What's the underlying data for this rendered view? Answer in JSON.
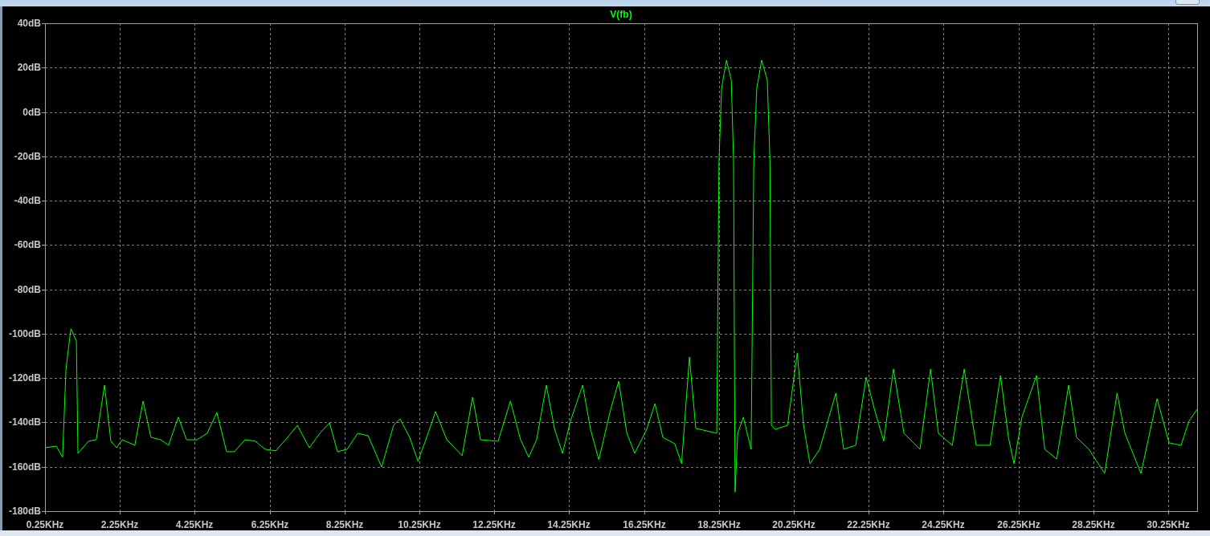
{
  "plot": {
    "chart_data": {
      "type": "line",
      "grid": true,
      "xlim": [
        0.25,
        31.02
      ],
      "ylim": [
        -180,
        40
      ],
      "yticks": [
        {
          "value": 40,
          "label": "40dB"
        },
        {
          "value": 20,
          "label": "20dB"
        },
        {
          "value": 0,
          "label": "0dB"
        },
        {
          "value": -20,
          "label": "-20dB"
        },
        {
          "value": -40,
          "label": "-40dB"
        },
        {
          "value": -60,
          "label": "-60dB"
        },
        {
          "value": -80,
          "label": "-80dB"
        },
        {
          "value": -100,
          "label": "-100dB"
        },
        {
          "value": -120,
          "label": "-120dB"
        },
        {
          "value": -140,
          "label": "-140dB"
        },
        {
          "value": -160,
          "label": "-160dB"
        },
        {
          "value": -180,
          "label": "-180dB"
        }
      ],
      "xticks": [
        {
          "value": 0.25,
          "label": "0.25KHz"
        },
        {
          "value": 2.25,
          "label": "2.25KHz"
        },
        {
          "value": 4.25,
          "label": "4.25KHz"
        },
        {
          "value": 6.25,
          "label": "6.25KHz"
        },
        {
          "value": 8.25,
          "label": "8.25KHz"
        },
        {
          "value": 10.25,
          "label": "10.25KHz"
        },
        {
          "value": 12.25,
          "label": "12.25KHz"
        },
        {
          "value": 14.25,
          "label": "14.25KHz"
        },
        {
          "value": 16.25,
          "label": "16.25KHz"
        },
        {
          "value": 18.25,
          "label": "18.25KHz"
        },
        {
          "value": 20.25,
          "label": "20.25KHz"
        },
        {
          "value": 22.25,
          "label": "22.25KHz"
        },
        {
          "value": 24.25,
          "label": "24.25KHz"
        },
        {
          "value": 26.25,
          "label": "26.25KHz"
        },
        {
          "value": 28.25,
          "label": "28.25KHz"
        },
        {
          "value": 30.25,
          "label": "30.25KHz"
        }
      ],
      "x": [
        0.25,
        0.55,
        0.72,
        0.81,
        0.94,
        1.09,
        1.13,
        1.41,
        1.62,
        1.84,
        2.01,
        2.16,
        2.31,
        2.65,
        2.87,
        3.08,
        3.34,
        3.55,
        3.81,
        4.03,
        4.31,
        4.58,
        4.84,
        5.1,
        5.31,
        5.59,
        5.87,
        6.13,
        6.41,
        6.73,
        6.99,
        7.31,
        7.59,
        7.85,
        8.06,
        8.32,
        8.6,
        8.88,
        9.24,
        9.56,
        9.73,
        9.99,
        10.21,
        10.42,
        10.68,
        10.98,
        11.39,
        11.67,
        11.88,
        12.35,
        12.68,
        12.95,
        13.17,
        13.38,
        13.64,
        13.86,
        14.07,
        14.28,
        14.61,
        14.82,
        15.04,
        15.36,
        15.57,
        15.79,
        16.0,
        16.32,
        16.54,
        16.75,
        17.07,
        17.25,
        17.46,
        17.63,
        17.82,
        18.19,
        18.25,
        18.32,
        18.45,
        18.58,
        18.64,
        18.68,
        18.75,
        18.9,
        19.11,
        19.18,
        19.26,
        19.39,
        19.54,
        19.61,
        19.65,
        19.76,
        20.08,
        20.34,
        20.51,
        20.68,
        20.94,
        21.37,
        21.58,
        21.9,
        22.18,
        22.4,
        22.65,
        22.91,
        23.19,
        23.62,
        23.9,
        24.11,
        24.48,
        24.8,
        25.12,
        25.49,
        25.77,
        25.98,
        26.13,
        26.34,
        26.73,
        26.95,
        27.27,
        27.59,
        27.8,
        28.13,
        28.55,
        28.88,
        29.09,
        29.52,
        29.95,
        30.27,
        30.59,
        30.8,
        31.02
      ],
      "series": [
        {
          "name": "V(fb)",
          "color": "#00ff00",
          "values": [
            -151.4,
            -150.7,
            -155.7,
            -115.9,
            -97.8,
            -103.3,
            -153.9,
            -148.5,
            -147.8,
            -123.2,
            -148.5,
            -151.4,
            -147.8,
            -150.3,
            -130.4,
            -146.7,
            -147.8,
            -150.3,
            -137.6,
            -147.8,
            -147.8,
            -144.9,
            -135.5,
            -153.2,
            -153.2,
            -147.8,
            -148.5,
            -152.1,
            -152.8,
            -146.7,
            -141.3,
            -151.4,
            -144.9,
            -140.2,
            -153.2,
            -152.1,
            -144.9,
            -146.0,
            -160.1,
            -141.3,
            -138.4,
            -146.7,
            -157.5,
            -147.8,
            -135.1,
            -147.8,
            -155.0,
            -128.6,
            -147.8,
            -148.5,
            -130.4,
            -147.8,
            -155.7,
            -147.8,
            -123.2,
            -143.1,
            -153.9,
            -139.5,
            -123.2,
            -143.1,
            -156.8,
            -134.0,
            -121.4,
            -144.9,
            -153.9,
            -143.1,
            -131.5,
            -146.7,
            -149.6,
            -158.6,
            -110.5,
            -142.7,
            -143.4,
            -144.9,
            -21.9,
            10.7,
            23.4,
            14.3,
            -21.9,
            -171.3,
            -144.9,
            -137.6,
            -152.1,
            -21.9,
            10.7,
            23.4,
            14.3,
            -21.9,
            -141.3,
            -143.1,
            -141.3,
            -108.7,
            -141.3,
            -158.6,
            -152.1,
            -126.8,
            -152.1,
            -150.3,
            -119.6,
            -134.0,
            -148.5,
            -115.9,
            -144.9,
            -152.1,
            -115.9,
            -144.9,
            -150.3,
            -115.9,
            -150.3,
            -150.3,
            -118.8,
            -146.7,
            -158.6,
            -137.6,
            -118.8,
            -152.1,
            -156.5,
            -123.2,
            -146.7,
            -152.1,
            -163.0,
            -126.8,
            -144.9,
            -163.0,
            -129.3,
            -149.2,
            -150.3,
            -139.5,
            -134.0
          ]
        }
      ]
    }
  }
}
